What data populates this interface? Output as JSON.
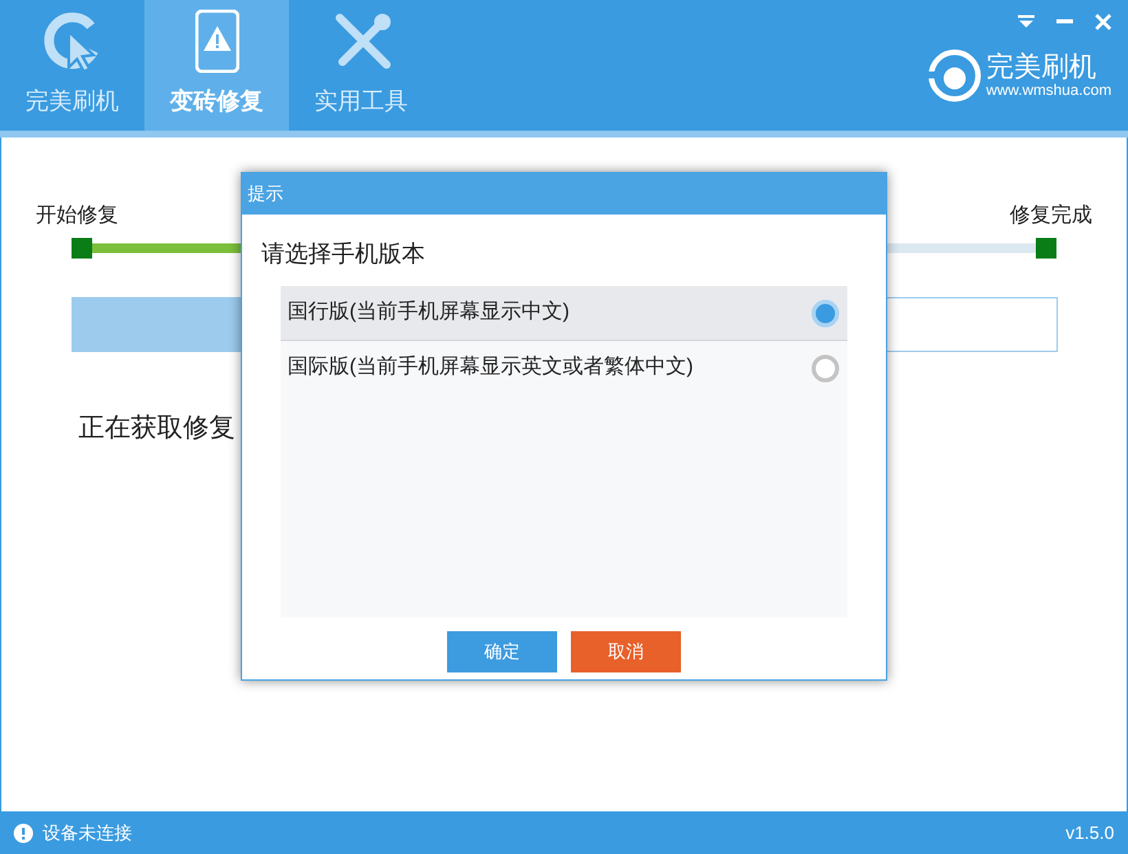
{
  "tabs": [
    {
      "label": "完美刷机",
      "kind": "flash",
      "selected": false
    },
    {
      "label": "变砖修复",
      "kind": "repair",
      "selected": true
    },
    {
      "label": "实用工具",
      "kind": "tools",
      "selected": false
    }
  ],
  "brand": {
    "name": "完美刷机",
    "url": "www.wmshua.com"
  },
  "steps": {
    "start_label": "开始修复",
    "end_label": "修复完成",
    "level": 0.2
  },
  "task_bar": {
    "level": 0.2
  },
  "status_message": "正在获取修复",
  "dialog": {
    "title": "提示",
    "prompt": "请选择手机版本",
    "options": [
      {
        "label": "国行版(当前手机屏幕显示中文)",
        "selected": true
      },
      {
        "label": "国际版(当前手机屏幕显示英文或者繁体中文)",
        "selected": false
      }
    ],
    "buttons": [
      {
        "label": "确定",
        "kind": "primary"
      },
      {
        "label": "取消",
        "kind": "danger"
      }
    ]
  },
  "status_bar": {
    "connection": "设备未连接",
    "version": "v1.5.0"
  }
}
